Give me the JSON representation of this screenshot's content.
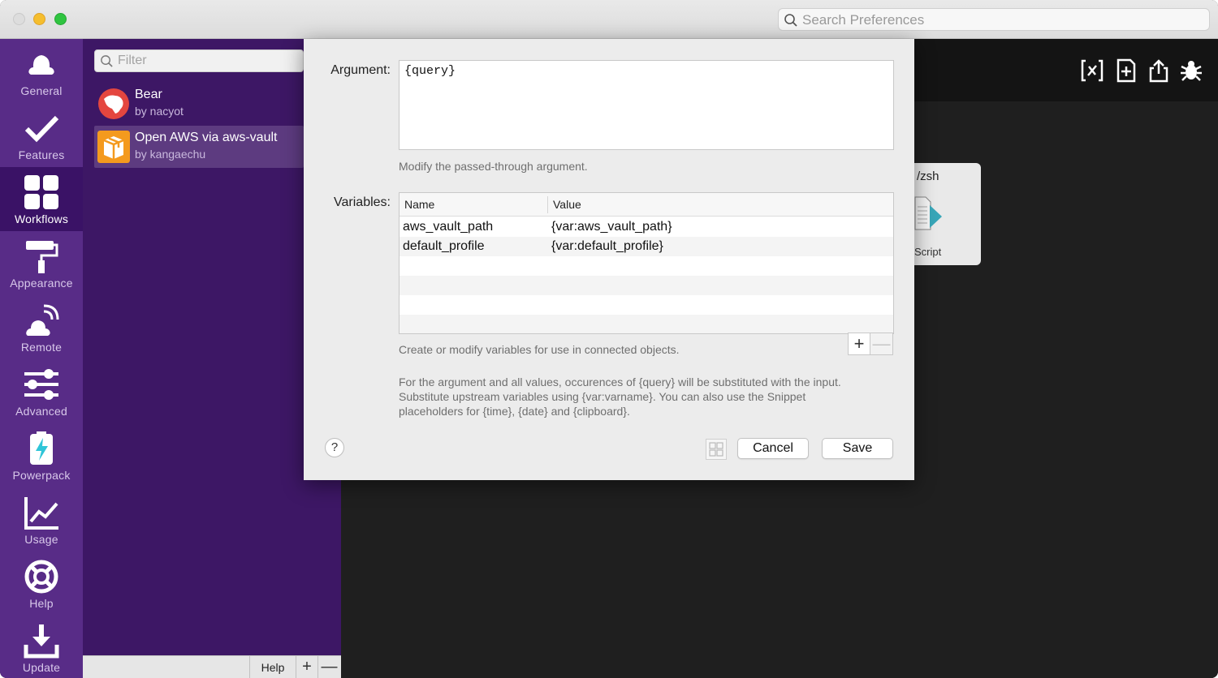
{
  "titlebar": {
    "search_placeholder": "Search Preferences"
  },
  "nav": {
    "items": [
      {
        "label": "General",
        "icon": "general-icon"
      },
      {
        "label": "Features",
        "icon": "checkmark-icon"
      },
      {
        "label": "Workflows",
        "icon": "workflows-grid-icon",
        "active": true
      },
      {
        "label": "Appearance",
        "icon": "paint-roller-icon"
      },
      {
        "label": "Remote",
        "icon": "remote-icon"
      },
      {
        "label": "Advanced",
        "icon": "sliders-icon"
      },
      {
        "label": "Powerpack",
        "icon": "powerpack-icon"
      },
      {
        "label": "Usage",
        "icon": "chart-icon"
      },
      {
        "label": "Help",
        "icon": "lifebuoy-icon"
      },
      {
        "label": "Update",
        "icon": "download-icon"
      }
    ]
  },
  "workflows": {
    "filter_placeholder": "Filter",
    "items": [
      {
        "title": "Bear",
        "author": "by nacyot",
        "icon": "bear-icon"
      },
      {
        "title": "Open AWS via aws-vault",
        "author": "by kangaechu",
        "icon": "box-icon",
        "selected": true
      }
    ],
    "bottom": {
      "help": "Help",
      "add": "+",
      "remove": "—"
    }
  },
  "canvas": {
    "node_label": " /zsh",
    "node_sub": "Script"
  },
  "dialog": {
    "argument_label": "Argument:",
    "argument_value": "{query}",
    "argument_hint": "Modify the passed-through argument.",
    "variables_label": "Variables:",
    "table": {
      "headers": [
        "Name",
        "Value"
      ],
      "rows": [
        {
          "name": "aws_vault_path",
          "value": "{var:aws_vault_path}"
        },
        {
          "name": "default_profile",
          "value": "{var:default_profile}"
        }
      ]
    },
    "variables_hint": "Create or modify variables for use in connected objects.",
    "info": "For the argument and all values, occurences of {query} will be substituted with the input. Substitute upstream variables using {var:varname}. You can also use the Snippet placeholders for {time}, {date} and {clipboard}.",
    "help": "?",
    "add": "+",
    "remove": "—",
    "cancel": "Cancel",
    "save": "Save"
  },
  "colors": {
    "nav_bg": "#582c87",
    "nav_active": "#3a1266",
    "list_bg": "#3d1765",
    "canvas_bg": "#1f1f1f",
    "dialog_bg": "#ececec"
  }
}
